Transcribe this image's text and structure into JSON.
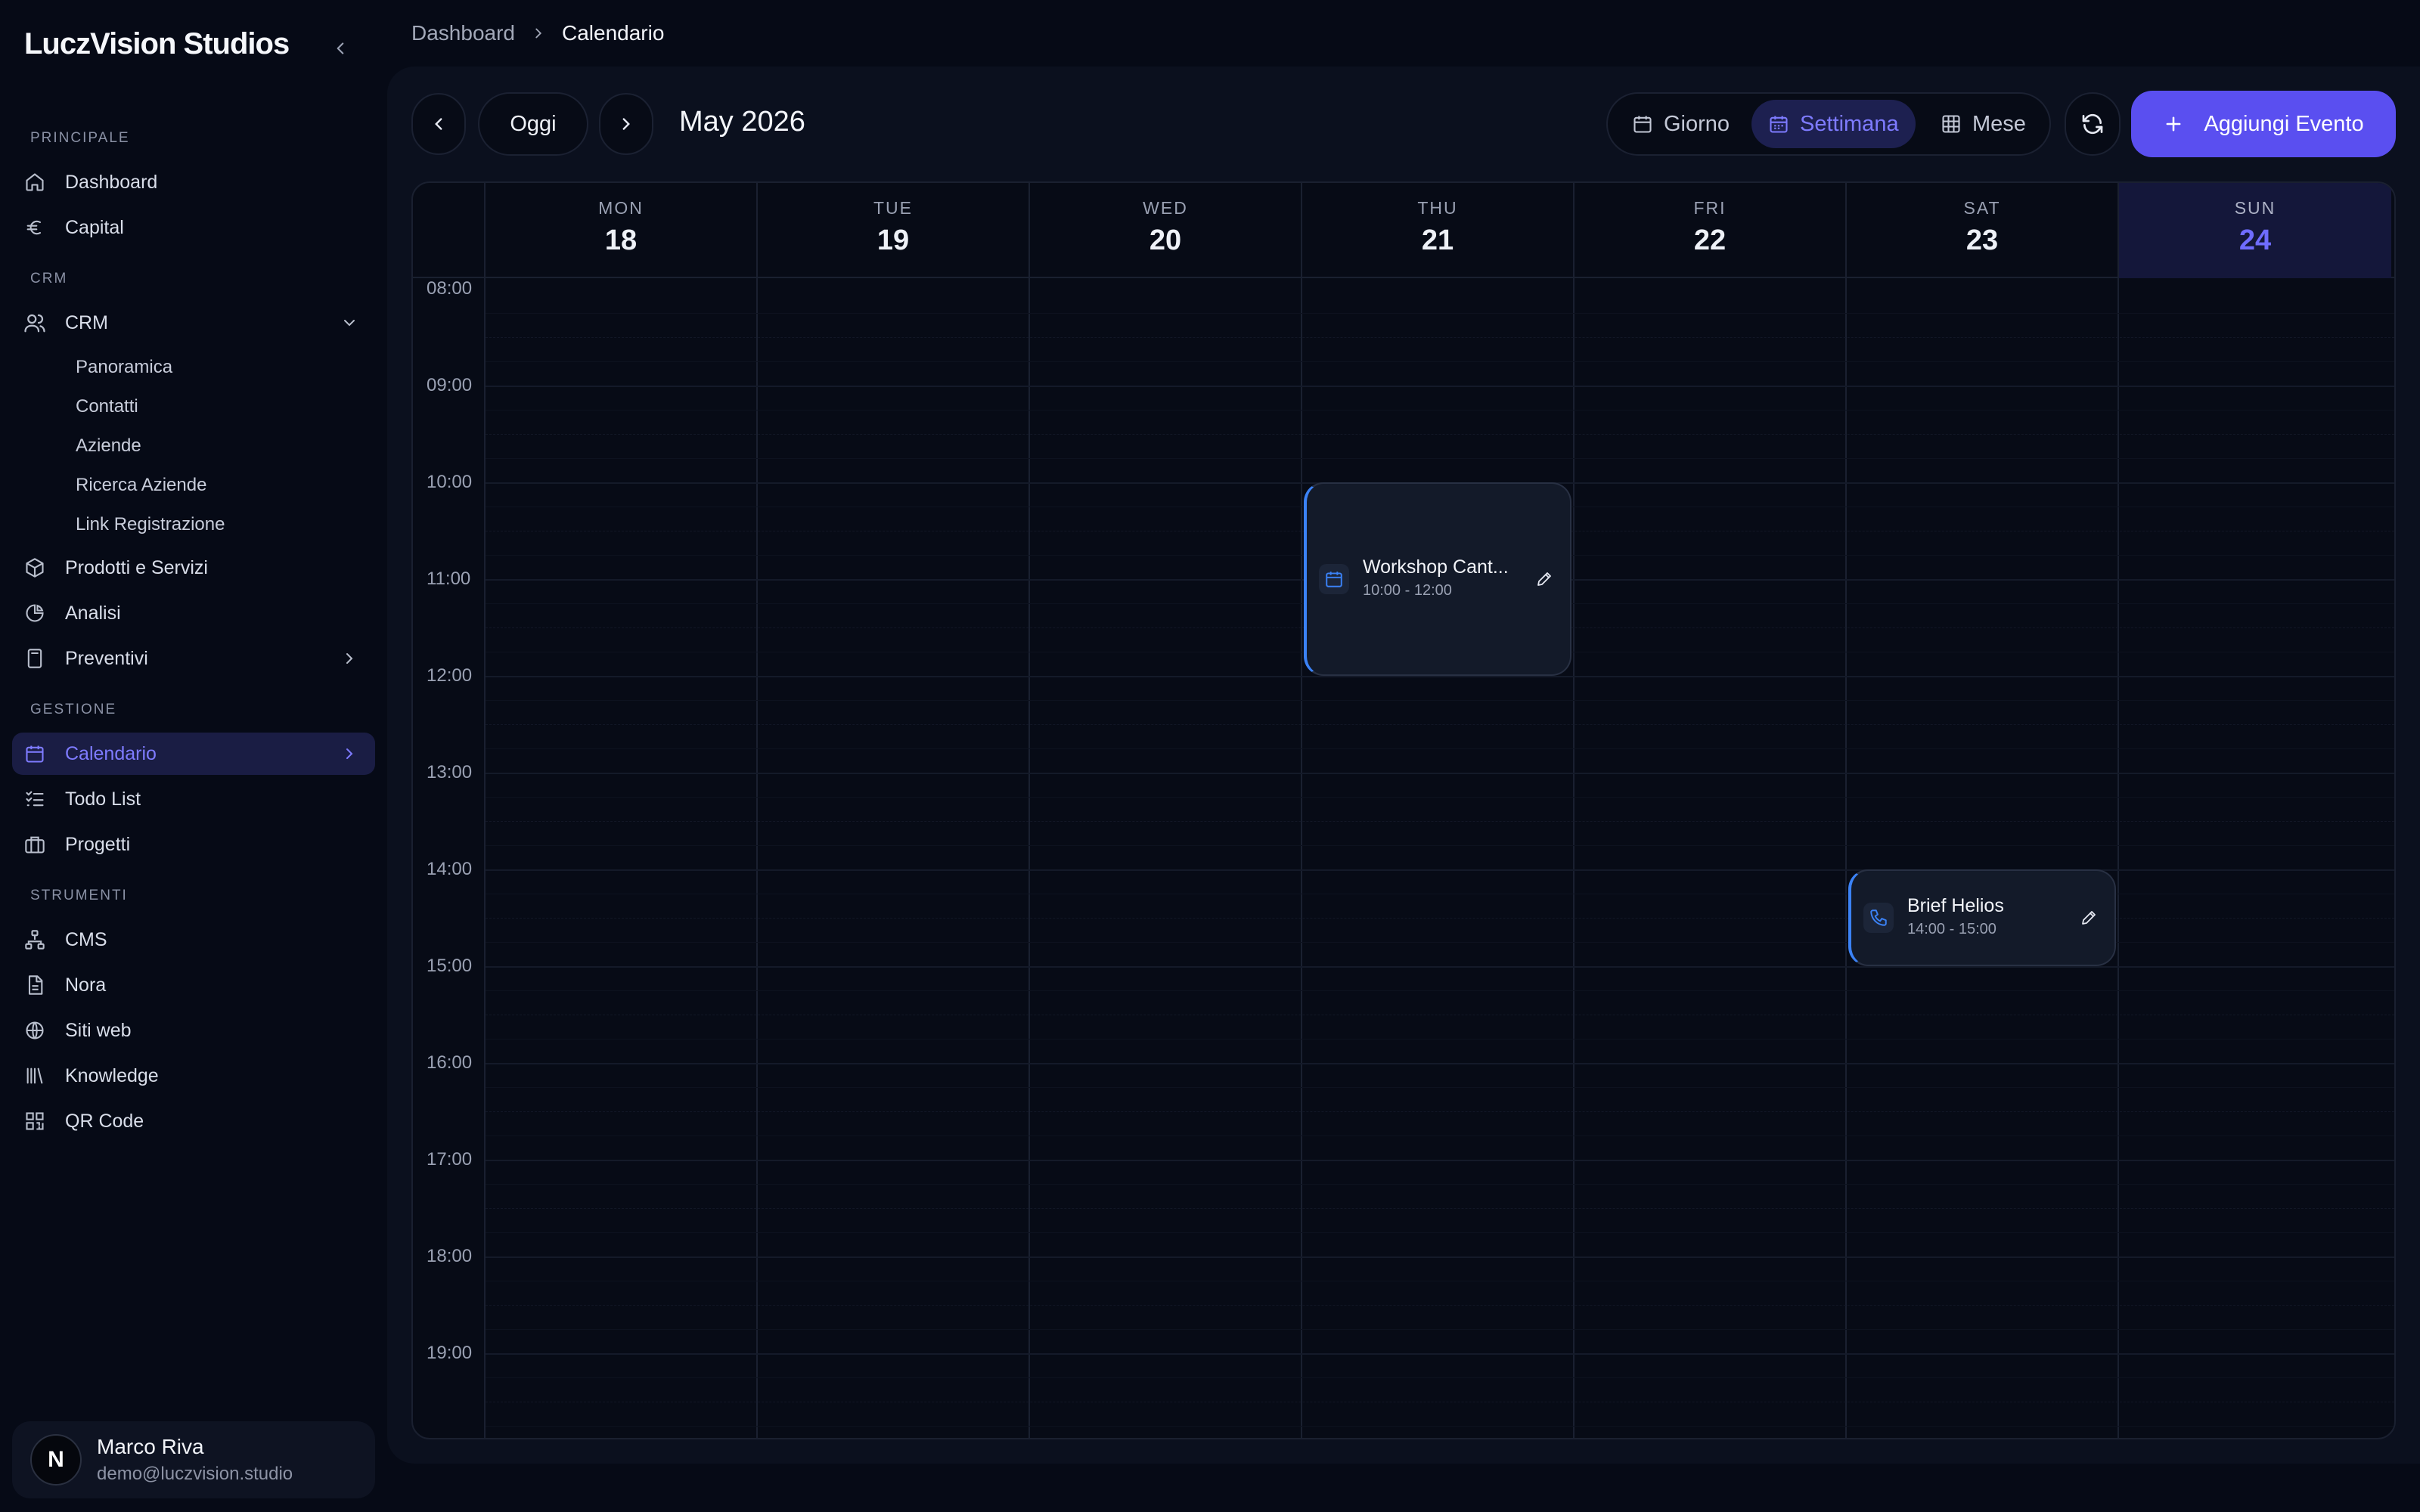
{
  "app": {
    "brand": "LuczVision Studios"
  },
  "breadcrumb": {
    "root": "Dashboard",
    "current": "Calendario"
  },
  "sidebar": {
    "sections": {
      "principale": "PRINCIPALE",
      "crm": "CRM",
      "gestione": "GESTIONE",
      "strumenti": "STRUMENTI"
    },
    "items": {
      "dashboard": "Dashboard",
      "capital": "Capital",
      "crm": "CRM",
      "prodotti": "Prodotti e Servizi",
      "analisi": "Analisi",
      "preventivi": "Preventivi",
      "calendario": "Calendario",
      "todo": "Todo List",
      "progetti": "Progetti",
      "cms": "CMS",
      "nora": "Nora",
      "siti": "Siti web",
      "knowledge": "Knowledge",
      "qr": "QR Code"
    },
    "crm_sub": {
      "panoramica": "Panoramica",
      "contatti": "Contatti",
      "aziende": "Aziende",
      "ricerca": "Ricerca Aziende",
      "link": "Link Registrazione"
    }
  },
  "user": {
    "name": "Marco Riva",
    "email": "demo@luczvision.studio",
    "avatar_letter": "N"
  },
  "toolbar": {
    "today": "Oggi",
    "month": "May 2026",
    "views": {
      "day": "Giorno",
      "week": "Settimana",
      "month": "Mese"
    },
    "active_view": "Settimana",
    "add_event": "Aggiungi Evento"
  },
  "calendar": {
    "days": [
      {
        "name": "MON",
        "num": "18"
      },
      {
        "name": "TUE",
        "num": "19"
      },
      {
        "name": "WED",
        "num": "20"
      },
      {
        "name": "THU",
        "num": "21"
      },
      {
        "name": "FRI",
        "num": "22"
      },
      {
        "name": "SAT",
        "num": "23"
      },
      {
        "name": "SUN",
        "num": "24",
        "today": true
      }
    ],
    "hours": [
      "08:00",
      "09:00",
      "10:00",
      "11:00",
      "12:00",
      "13:00",
      "14:00",
      "15:00",
      "16:00",
      "17:00",
      "18:00",
      "19:00"
    ],
    "events": [
      {
        "title": "Workshop Cant...",
        "time": "10:00 - 12:00",
        "day": "THU",
        "icon": "calendar-icon"
      },
      {
        "title": "Brief Helios",
        "time": "14:00 - 15:00",
        "day": "SAT",
        "icon": "phone-icon"
      }
    ]
  },
  "colors": {
    "accent": "#5a4ff0",
    "accent_text": "#7e7bff",
    "event_border": "#3b82f6",
    "background": "#060a16",
    "panel": "#0b101e"
  }
}
